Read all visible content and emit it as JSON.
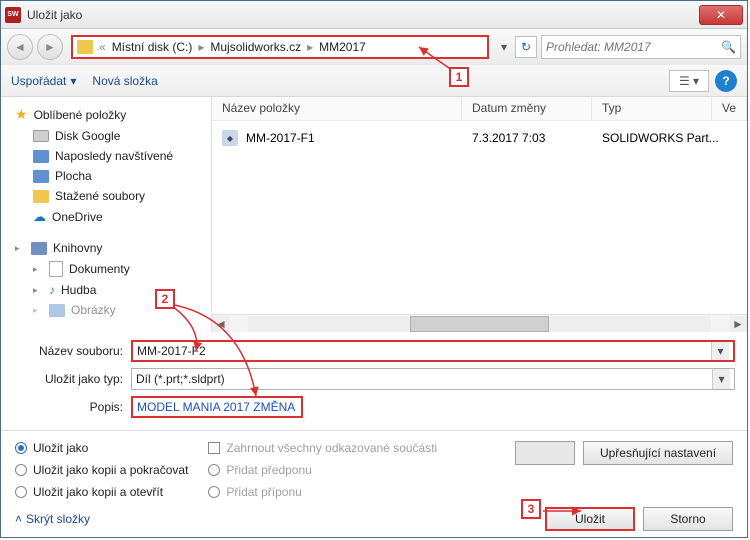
{
  "title": "Uložit jako",
  "breadcrumb": {
    "prefix": "«",
    "items": [
      "Místní disk (C:)",
      "Mujsolidworks.cz",
      "MM2017"
    ]
  },
  "search": {
    "placeholder": "Prohledat: MM2017"
  },
  "toolbar": {
    "organize": "Uspořádat",
    "new_folder": "Nová složka"
  },
  "sidebar": {
    "favorites": "Oblíbené položky",
    "items": [
      "Disk Google",
      "Naposledy navštívené",
      "Plocha",
      "Stažené soubory",
      "OneDrive"
    ],
    "libraries": "Knihovny",
    "lib_items": [
      "Dokumenty",
      "Hudba",
      "Obrázky"
    ]
  },
  "file_header": {
    "name": "Název položky",
    "date": "Datum změny",
    "type": "Typ",
    "ver": "Ve"
  },
  "file_row": {
    "name": "MM-2017-F1",
    "date": "7.3.2017 7:03",
    "type": "SOLIDWORKS Part..."
  },
  "form": {
    "filename_label": "Název souboru:",
    "filename_value": "MM-2017-F2",
    "type_label": "Uložit jako typ:",
    "type_value": "Díl (*.prt;*.sldprt)",
    "desc_label": "Popis:",
    "desc_value": "MODEL MANIA 2017 ZMĚNA"
  },
  "options": {
    "save_as": "Uložit jako",
    "save_copy_continue": "Uložit jako kopii a pokračovat",
    "save_copy_open": "Uložit jako kopii a otevřít",
    "include_refs": "Zahrnout všechny odkazované součásti",
    "add_prefix": "Přidat předponu",
    "add_suffix": "Přidat příponu",
    "advanced": "Upřesňující nastavení"
  },
  "footer": {
    "hide_folders": "Skrýt složky",
    "save": "Uložit",
    "cancel": "Storno"
  },
  "callouts": {
    "c1": "1",
    "c2": "2",
    "c3": "3"
  }
}
